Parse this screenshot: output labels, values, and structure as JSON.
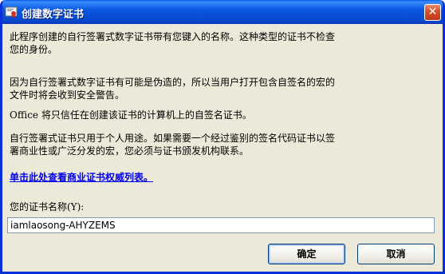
{
  "window": {
    "title": "创建数字证书",
    "close_glyph": "✕"
  },
  "content": {
    "para1": "此程序创建的自行签署式数字证书带有您键入的名称。这种类型的证书不检查\n您的身份。",
    "para2": "因为自行签署式数字证书有可能是伪造的，所以当用户打开包含自签名的宏的\n文件时将会收到安全警告。",
    "para3": "Office 将只信任在创建该证书的计算机上的自签名证书。",
    "para4": "自行签署式证书只用于个人用途。如果需要一个经过鉴别的签名代码证书以签\n署商业性或广泛分发的宏，您必须与证书颁发机构联系。",
    "link": "单击此处查看商业证书权威列表。",
    "field_label": "您的证书名称(Y):",
    "field_value": "iamlaosong-AHYZEMS"
  },
  "buttons": {
    "ok": "确定",
    "cancel": "取消"
  },
  "colors": {
    "titlebar": "#0a58e0",
    "window_bg": "#ece9d8",
    "link": "#0000ee"
  }
}
